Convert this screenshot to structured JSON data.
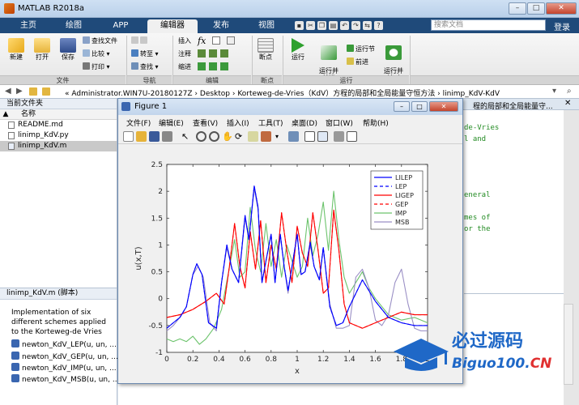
{
  "window": {
    "title": "MATLAB R2018a",
    "min": "–",
    "max": "□",
    "close": "✕"
  },
  "tabs": [
    "主页",
    "绘图",
    "APP",
    "编辑器",
    "发布",
    "视图"
  ],
  "active_tab": "编辑器",
  "search": {
    "placeholder": "搜索文档"
  },
  "login": "登录",
  "ribbon": {
    "file": {
      "new": "新建",
      "open": "打开",
      "save": "保存",
      "find_files": "查找文件",
      "compare": "比较",
      "print": "打印",
      "label": "文件"
    },
    "nav": {
      "goto": "转至",
      "find": "查找",
      "label": "导航"
    },
    "edit": {
      "insert": "插入",
      "comment": "注释",
      "indent": "缩进",
      "fx": "fx",
      "label": "编辑"
    },
    "breakpoints": {
      "bp": "断点",
      "label": "断点"
    },
    "run": {
      "run": "运行",
      "run_advance": "运行并\n前进",
      "run_section": "运行节",
      "advance": "前进",
      "run_time": "运行并\n计时",
      "label": "运行"
    }
  },
  "address": {
    "path": "« Administrator.WIN7U-20180127Z  ›  Desktop  ›  Korteweg-de-Vries（KdV）方程的局部和全局能量守恒方法  ›  linimp_KdV-KdV"
  },
  "left_panel": {
    "title": "当前文件夹",
    "column": "名称",
    "column_sort": "▲",
    "files": [
      {
        "name": "README.md",
        "selected": false
      },
      {
        "name": "linimp_KdV.py",
        "selected": false
      },
      {
        "name": "linimp_KdV.m",
        "selected": true
      }
    ]
  },
  "details": {
    "title": "linimp_KdV.m  (脚本)",
    "description": "Implementation of six different schemes applied to the Korteweg-de Vries",
    "functions": [
      "newton_KdV_LEP(u, un, ...",
      "newton_KdV_GEP(u, un, ...",
      "newton_KdV_IMP(u, un, ...",
      "newton_KdV_MSB(u, un, ..."
    ]
  },
  "editor": {
    "tab_text": "程的局部和全局能量守...",
    "code_lines": [
      "de-Vries",
      "l and",
      "eneral",
      "mes of",
      "or the"
    ]
  },
  "figure": {
    "title": "Figure 1",
    "menu": [
      "文件(F)",
      "编辑(E)",
      "查看(V)",
      "插入(I)",
      "工具(T)",
      "桌面(D)",
      "窗口(W)",
      "帮助(H)"
    ]
  },
  "chart_data": {
    "type": "line",
    "xlabel": "x",
    "ylabel": "u(x,T)",
    "xlim": [
      0,
      2
    ],
    "ylim": [
      -1,
      2.5
    ],
    "xticks": [
      "0",
      "0.2",
      "0.4",
      "0.6",
      "0.8",
      "1",
      "1.2",
      "1.4",
      "1.6",
      "1.8",
      "2"
    ],
    "yticks": [
      "-1",
      "-0.5",
      "0",
      "0.5",
      "1",
      "1.5",
      "2",
      "2.5"
    ],
    "legend_position": "top-right",
    "series": [
      {
        "name": "LILEP",
        "color": "#0000ff",
        "style": "solid",
        "x": [
          0,
          0.05,
          0.1,
          0.15,
          0.2,
          0.23,
          0.27,
          0.32,
          0.38,
          0.42,
          0.46,
          0.5,
          0.55,
          0.6,
          0.63,
          0.67,
          0.7,
          0.73,
          0.76,
          0.8,
          0.83,
          0.87,
          0.9,
          0.93,
          0.97,
          1.0,
          1.03,
          1.06,
          1.1,
          1.13,
          1.17,
          1.2,
          1.25,
          1.3,
          1.35,
          1.4,
          1.5,
          1.6,
          1.7,
          1.8,
          1.9,
          2.0
        ],
        "y": [
          -0.55,
          -0.45,
          -0.35,
          -0.15,
          0.45,
          0.65,
          0.45,
          -0.45,
          -0.55,
          0.3,
          1.0,
          0.55,
          0.3,
          1.55,
          1.1,
          2.1,
          1.7,
          0.3,
          0.7,
          1.2,
          0.3,
          1.2,
          0.6,
          0.15,
          0.75,
          1.2,
          0.45,
          0.5,
          1.05,
          0.6,
          0.35,
          0.95,
          -0.15,
          -0.5,
          -0.45,
          -0.15,
          0.35,
          -0.05,
          -0.35,
          -0.45,
          -0.5,
          -0.5
        ]
      },
      {
        "name": "LEP",
        "color": "#0000ff",
        "style": "dashed",
        "x": [
          0,
          0.05,
          0.1,
          0.15,
          0.2,
          0.23,
          0.27,
          0.32,
          0.38,
          0.42,
          0.46,
          0.5,
          0.55,
          0.6,
          0.63,
          0.67,
          0.7,
          0.73,
          0.76,
          0.8,
          0.83,
          0.87,
          0.9,
          0.93,
          0.97,
          1.0,
          1.03,
          1.06,
          1.1,
          1.13,
          1.17,
          1.2,
          1.25,
          1.3,
          1.35,
          1.4,
          1.5,
          1.6,
          1.7,
          1.8,
          1.9,
          2.0
        ],
        "y": [
          -0.55,
          -0.45,
          -0.35,
          -0.15,
          0.45,
          0.65,
          0.45,
          -0.45,
          -0.55,
          0.3,
          1.0,
          0.55,
          0.3,
          1.55,
          1.1,
          2.1,
          1.7,
          0.3,
          0.7,
          1.2,
          0.3,
          1.2,
          0.6,
          0.15,
          0.75,
          1.2,
          0.45,
          0.5,
          1.05,
          0.6,
          0.35,
          0.95,
          -0.15,
          -0.5,
          -0.45,
          -0.15,
          0.35,
          -0.05,
          -0.35,
          -0.45,
          -0.5,
          -0.5
        ]
      },
      {
        "name": "LIGEP",
        "color": "#ff0000",
        "style": "solid",
        "x": [
          0,
          0.1,
          0.2,
          0.3,
          0.38,
          0.44,
          0.48,
          0.52,
          0.56,
          0.6,
          0.64,
          0.68,
          0.72,
          0.76,
          0.8,
          0.84,
          0.88,
          0.92,
          0.96,
          1.0,
          1.04,
          1.08,
          1.12,
          1.16,
          1.2,
          1.24,
          1.28,
          1.32,
          1.36,
          1.4,
          1.5,
          1.6,
          1.7,
          1.8,
          1.9,
          2.0
        ],
        "y": [
          -0.35,
          -0.3,
          -0.2,
          -0.05,
          0.1,
          -0.1,
          0.6,
          1.4,
          0.6,
          0.2,
          1.25,
          0.55,
          1.45,
          0.3,
          1.0,
          0.55,
          1.6,
          0.9,
          0.3,
          1.35,
          0.85,
          0.6,
          1.6,
          0.9,
          0.1,
          0.2,
          1.65,
          0.9,
          -0.1,
          -0.45,
          -0.55,
          -0.45,
          -0.35,
          -0.25,
          -0.3,
          -0.3
        ]
      },
      {
        "name": "GEP",
        "color": "#ff0000",
        "style": "dashed",
        "x": [
          0,
          0.1,
          0.2,
          0.3,
          0.38,
          0.44,
          0.48,
          0.52,
          0.56,
          0.6,
          0.64,
          0.68,
          0.72,
          0.76,
          0.8,
          0.84,
          0.88,
          0.92,
          0.96,
          1.0,
          1.04,
          1.08,
          1.12,
          1.16,
          1.2,
          1.24,
          1.28,
          1.32,
          1.36,
          1.4,
          1.5,
          1.6,
          1.7,
          1.8,
          1.9,
          2.0
        ],
        "y": [
          -0.35,
          -0.3,
          -0.2,
          -0.05,
          0.1,
          -0.1,
          0.6,
          1.4,
          0.6,
          0.2,
          1.25,
          0.55,
          1.45,
          0.3,
          1.0,
          0.55,
          1.6,
          0.9,
          0.3,
          1.35,
          0.85,
          0.6,
          1.6,
          0.9,
          0.1,
          0.2,
          1.65,
          0.9,
          -0.1,
          -0.45,
          -0.55,
          -0.45,
          -0.35,
          -0.25,
          -0.3,
          -0.3
        ]
      },
      {
        "name": "IMP",
        "color": "#6cc36c",
        "style": "solid",
        "x": [
          0,
          0.05,
          0.1,
          0.15,
          0.2,
          0.25,
          0.3,
          0.36,
          0.42,
          0.47,
          0.52,
          0.56,
          0.6,
          0.64,
          0.68,
          0.72,
          0.76,
          0.8,
          0.84,
          0.88,
          0.92,
          0.96,
          1.0,
          1.04,
          1.08,
          1.12,
          1.16,
          1.2,
          1.24,
          1.28,
          1.32,
          1.36,
          1.4,
          1.45,
          1.5,
          1.55,
          1.6,
          1.7,
          1.8,
          1.9,
          2.0
        ],
        "y": [
          -0.75,
          -0.8,
          -0.75,
          -0.8,
          -0.7,
          -0.85,
          -0.75,
          -0.55,
          -0.2,
          0.45,
          1.1,
          0.4,
          0.5,
          1.7,
          0.9,
          0.5,
          1.4,
          0.6,
          1.1,
          0.4,
          1.0,
          0.7,
          0.4,
          0.6,
          1.5,
          0.8,
          1.2,
          1.8,
          0.9,
          2.0,
          1.1,
          0.4,
          0.1,
          0.3,
          0.5,
          0.2,
          0.0,
          -0.3,
          -0.4,
          -0.35,
          -0.45
        ]
      },
      {
        "name": "MSB",
        "color": "#9a8fc5",
        "style": "solid",
        "x": [
          0,
          0.05,
          0.1,
          0.15,
          0.2,
          0.24,
          0.28,
          0.33,
          0.38,
          0.42,
          0.46,
          0.5,
          0.55,
          0.6,
          0.63,
          0.67,
          0.7,
          0.73,
          0.76,
          0.8,
          0.83,
          0.87,
          0.9,
          0.93,
          0.97,
          1.0,
          1.03,
          1.06,
          1.1,
          1.13,
          1.17,
          1.2,
          1.25,
          1.3,
          1.35,
          1.4,
          1.45,
          1.5,
          1.55,
          1.6,
          1.65,
          1.7,
          1.75,
          1.8,
          1.85,
          1.9,
          1.95,
          2.0
        ],
        "y": [
          -0.6,
          -0.5,
          -0.35,
          -0.15,
          0.45,
          0.6,
          0.4,
          -0.45,
          -0.6,
          0.3,
          0.95,
          0.55,
          0.3,
          1.5,
          1.1,
          2.05,
          1.65,
          0.3,
          0.7,
          1.2,
          0.3,
          1.2,
          0.6,
          0.1,
          0.75,
          1.2,
          0.45,
          0.5,
          1.0,
          0.6,
          0.35,
          0.95,
          -0.1,
          -0.55,
          -0.55,
          -0.5,
          0.4,
          0.55,
          0.2,
          -0.4,
          -0.5,
          -0.3,
          0.3,
          0.55,
          -0.1,
          -0.55,
          -0.6,
          -0.6
        ]
      }
    ]
  }
}
